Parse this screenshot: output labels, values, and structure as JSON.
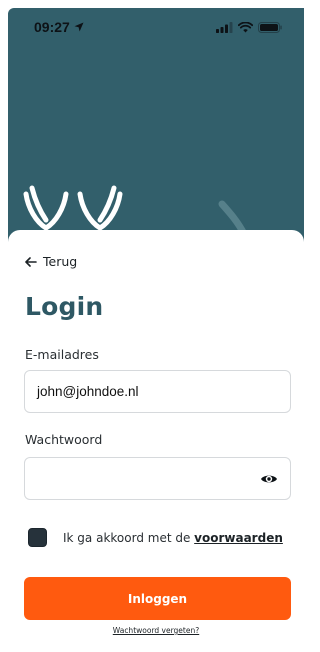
{
  "status_bar": {
    "time": "09:27",
    "icons": [
      "location-arrow-icon",
      "cellular-signal-icon",
      "wifi-icon",
      "battery-icon"
    ]
  },
  "hero": {
    "background_color": "#325f6b",
    "logo_icon": "antler-logo-icon"
  },
  "nav": {
    "back_label": "Terug",
    "back_icon": "arrow-left-icon"
  },
  "login": {
    "title": "Login",
    "email_label": "E-mailadres",
    "email_value": "john@johndoe.nl",
    "password_label": "Wachtwoord",
    "password_value": "",
    "password_toggle_icon": "eye-icon",
    "terms_prefix": "Ik ga akkoord met de",
    "terms_link": "voorwaarden",
    "terms_checked": false,
    "submit_label": "Inloggen",
    "forgot_label": "Wachtwoord vergeten?"
  },
  "colors": {
    "brand_dark": "#2e5864",
    "accent": "#ff5a0f",
    "checkbox": "#26323b"
  }
}
